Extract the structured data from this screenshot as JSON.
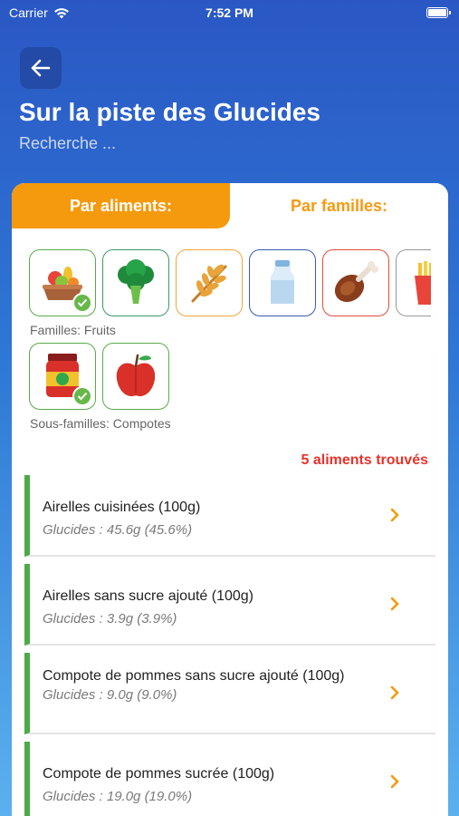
{
  "status_bar": {
    "carrier": "Carrier",
    "time": "7:52 PM"
  },
  "header": {
    "title": "Sur la piste des Glucides",
    "search_placeholder": "Recherche ..."
  },
  "tabs": [
    {
      "label": "Par aliments:",
      "active": true
    },
    {
      "label": "Par familles:",
      "active": false
    }
  ],
  "families": {
    "label": "Familles: Fruits",
    "items": [
      {
        "name": "fruits-basket-icon",
        "border": "#5aaa4a",
        "selected": true
      },
      {
        "name": "broccoli-icon",
        "border": "#3a9a6a",
        "selected": false
      },
      {
        "name": "wheat-icon",
        "border": "#f0a63a",
        "selected": false
      },
      {
        "name": "milk-bottle-icon",
        "border": "#3a5ab0",
        "selected": false
      },
      {
        "name": "chicken-leg-icon",
        "border": "#e04a3a",
        "selected": false
      },
      {
        "name": "fries-icon",
        "border": "#999999",
        "selected": false
      }
    ]
  },
  "subfamilies": {
    "label": "Sous-familles: Compotes",
    "items": [
      {
        "name": "jam-jar-icon",
        "border": "#5aaa4a",
        "selected": true
      },
      {
        "name": "apple-icon",
        "border": "#5aaa4a",
        "selected": false
      }
    ]
  },
  "results": {
    "count_text": "5 aliments trouvés",
    "items": [
      {
        "name": "Airelles cuisinées (100g)",
        "carbs": "Glucides : 45.6g (45.6%)"
      },
      {
        "name": "Airelles sans sucre ajouté (100g)",
        "carbs": "Glucides : 3.9g (3.9%)"
      },
      {
        "name": "Compote de pommes sans sucre ajouté (100g)",
        "carbs": "Glucides : 9.0g (9.0%)"
      },
      {
        "name": "Compote de pommes sucrée (100g)",
        "carbs": "Glucides : 19.0g (19.0%)"
      }
    ]
  },
  "colors": {
    "accent": "#f59a0c",
    "found": "#e8322a",
    "list_bar": "#4caa47"
  }
}
